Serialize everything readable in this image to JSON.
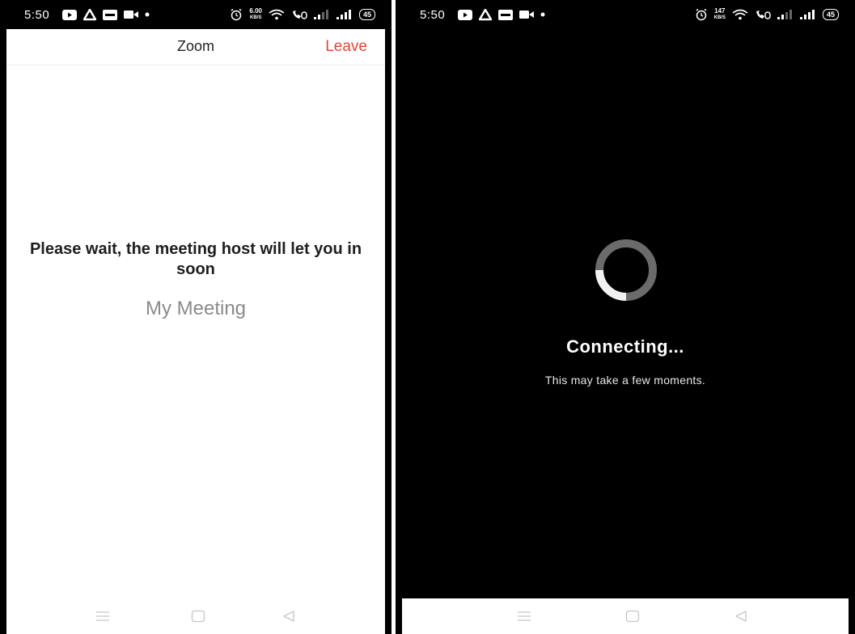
{
  "status_bar_left": {
    "time": "5:50",
    "speed_value": "6.00",
    "speed_unit": "KB/S",
    "battery": "45",
    "icons": [
      "youtube-icon",
      "drive-icon",
      "app-icon",
      "video-call-icon",
      "dot-icon",
      "alarm-icon",
      "wifi-icon",
      "call-icon",
      "signal-icon",
      "signal-icon",
      "battery-icon"
    ]
  },
  "status_bar_right": {
    "time": "5:50",
    "speed_value": "147",
    "speed_unit": "KB/S",
    "battery": "45"
  },
  "waiting_room": {
    "title": "Zoom",
    "leave_label": "Leave",
    "message": "Please wait, the meeting host will let you in soon",
    "meeting_name": "My Meeting"
  },
  "connecting_screen": {
    "title": "Connecting...",
    "subtitle": "This may take a few moments."
  },
  "nav_bar": {
    "icons": [
      "menu-icon",
      "home-icon",
      "back-icon"
    ]
  },
  "colors": {
    "leave_accent": "#e0453b",
    "status_bar_bg": "#000000",
    "dark_screen_bg": "#000000",
    "nav_icon": "#c6c6c6"
  }
}
